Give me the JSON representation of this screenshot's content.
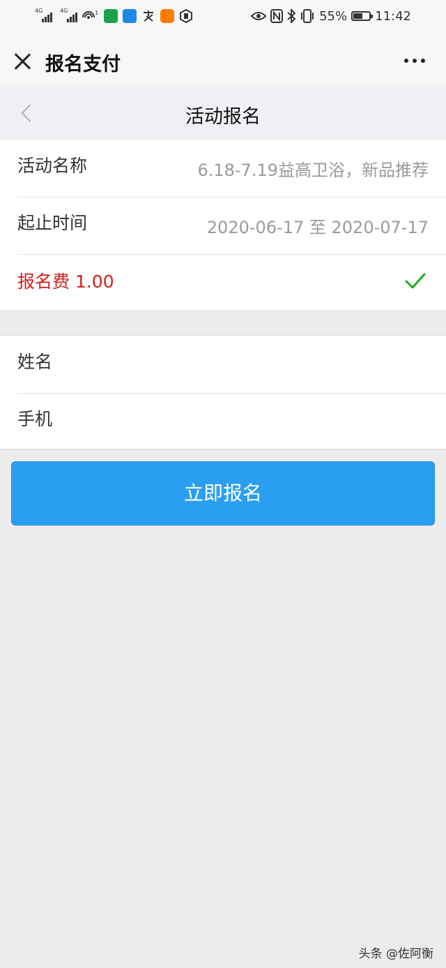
{
  "status_bar": {
    "network_1": "4G",
    "network_2": "4G",
    "wifi_sup": "1",
    "battery_percent": "55%",
    "time": "11:42",
    "icons": [
      "signal-icon",
      "signal-icon",
      "wifi-icon",
      "app-icon",
      "app-icon",
      "alipay-icon",
      "app-icon",
      "app-icon",
      "eye-icon",
      "nfc-icon",
      "bluetooth-icon",
      "vibrate-icon",
      "battery-icon"
    ],
    "battery_level": 0.55
  },
  "title_bar": {
    "title": "报名支付"
  },
  "nav": {
    "title": "活动报名"
  },
  "info": {
    "rows": [
      {
        "label": "活动名称",
        "value": "6.18-7.19益高卫浴，新品推荐"
      },
      {
        "label": "起止时间",
        "value": "2020-06-17 至 2020-07-17"
      }
    ],
    "fee_label": "报名费 1.00",
    "fee_selected": true
  },
  "form": {
    "name_label": "姓名",
    "phone_label": "手机",
    "name_value": "",
    "phone_value": ""
  },
  "submit_label": "立即报名",
  "watermark": "头条 @佐阿衡",
  "colors": {
    "accent": "#2a9ff2",
    "fee_red": "#d0201b",
    "check_green": "#1aad19",
    "background": "#ececec"
  }
}
